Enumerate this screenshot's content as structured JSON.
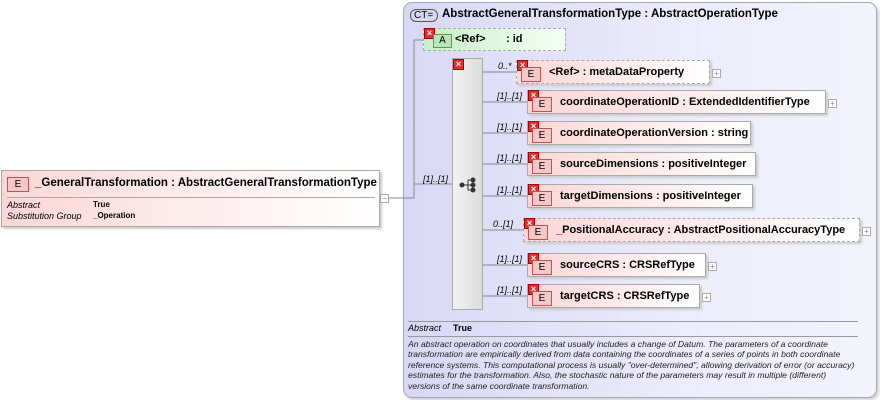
{
  "element": {
    "badge": "E",
    "name": "_GeneralTransformation",
    "type": "AbstractGeneralTransformationType",
    "props": [
      {
        "label": "Abstract",
        "value": "True"
      },
      {
        "label": "Substitution Group",
        "value": "_Operation"
      }
    ],
    "collapse": "−"
  },
  "connector_cardinality": "[1]..[1]",
  "complex_type": {
    "badge": "CT",
    "title": "AbstractGeneralTransformationType : AbstractOperationType",
    "attribute": {
      "badge": "A",
      "ref": "<Ref>",
      "name": ": id"
    },
    "children": [
      {
        "card": "0..*",
        "label": "<Ref>      : metaDataProperty",
        "expand": "+"
      },
      {
        "card": "[1]..[1]",
        "label": "coordinateOperationID : ExtendedIdentifierType",
        "expand": "+"
      },
      {
        "card": "[1]..[1]",
        "label": "coordinateOperationVersion : string",
        "expand": ""
      },
      {
        "card": "[1]..[1]",
        "label": "sourceDimensions : positiveInteger",
        "expand": ""
      },
      {
        "card": "[1]..[1]",
        "label": "targetDimensions : positiveInteger",
        "expand": ""
      },
      {
        "card": "0..[1]",
        "label": "_PositionalAccuracy : AbstractPositionalAccuracyType",
        "expand": "+"
      },
      {
        "card": "[1]..[1]",
        "label": "sourceCRS : CRSRefType",
        "expand": "+"
      },
      {
        "card": "[1]..[1]",
        "label": "targetCRS : CRSRefType",
        "expand": "+"
      }
    ],
    "abstract_label": "Abstract",
    "abstract_value": "True",
    "description": "An abstract operation on coordinates that usually includes a change of Datum. The parameters of a coordinate transformation are empirically derived from data containing the coordinates of a series of points in both coordinate reference systems. This computational process is usually \"over-determined\", allowing derivation of error (or accuracy) estimates for the transformation. Also, the stochastic nature of the parameters may result in multiple (different) versions of the same coordinate transformation."
  }
}
